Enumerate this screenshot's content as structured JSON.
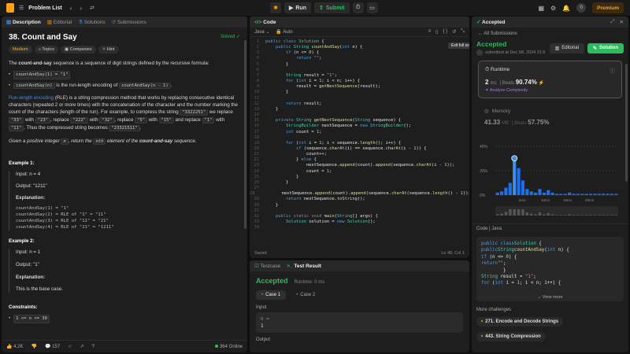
{
  "topbar": {
    "title": "Problem List",
    "run": "Run",
    "submit": "Submit",
    "avatar": "0",
    "premium": "Premium"
  },
  "left": {
    "tabs": [
      "Description",
      "Editorial",
      "Solutions",
      "Submissions"
    ],
    "title": "38. Count and Say",
    "solved": "Solved",
    "tags": [
      "Medium",
      "Topics",
      "Companies",
      "Hint"
    ],
    "intro_b": "count-and-say",
    "intro_pre": "The ",
    "intro_post": " sequence is a sequence of digit strings defined by the recursive formula:",
    "bul1": "countAndSay(1) = \"1\"",
    "bul2_code": "countAndSay(n)",
    "bul2_text": " is the run-length encoding of ",
    "bul2_code2": "countAndSay(n - 1)",
    "bul2_end": ".",
    "rle_link": "Run-length encoding",
    "rle_text": " (RLE) is a string compression method that works by replacing consecutive identical characters (repeated 2 or more times) with the concatenation of the character and the number marking the count of the characters (length of the run). For example, to compress the string ",
    "rle_c1": "\"3322251\"",
    "rle_t2": " we replace ",
    "rle_c2": "\"33\"",
    "rle_t3": " with ",
    "rle_c3": "\"23\"",
    "rle_t4": ", replace ",
    "rle_c4": "\"222\"",
    "rle_t5": " with ",
    "rle_c5": "\"32\"",
    "rle_t6": ", replace ",
    "rle_c6": "\"5\"",
    "rle_t7": " with ",
    "rle_c7": "\"15\"",
    "rle_t8": " and replace ",
    "rle_c8": "\"1\"",
    "rle_t9": " with ",
    "rle_c9": "\"11\"",
    "rle_t10": ". Thus the compressed string becomes ",
    "rle_c10": "\"23321511\"",
    "rle_t11": ".",
    "given_pre": "Given a positive integer ",
    "given_n": "n",
    "given_mid": ", return the ",
    "given_nth": "nth",
    "given_mid2": " element of the ",
    "given_b": "count-and-say",
    "given_end": " sequence.",
    "ex1": "Example 1:",
    "ex1_input": "Input: n = 4",
    "ex1_output": "Output: \"1211\"",
    "ex1_expl": "Explanation:",
    "ex1_lines": [
      "countAndSay(1) = \"1\"",
      "countAndSay(2) = RLE of \"1\" = \"11\"",
      "countAndSay(3) = RLE of \"11\" = \"21\"",
      "countAndSay(4) = RLE of \"21\" = \"1211\""
    ],
    "ex2": "Example 2:",
    "ex2_input": "Input: n = 1",
    "ex2_output": "Output: \"1\"",
    "ex2_expl": "Explanation:",
    "ex2_text": "This is the base case.",
    "constraints": "Constraints:",
    "con1": "1 <= n <= 30",
    "footer": {
      "likes": "4.2K",
      "comments": "157",
      "online": "364 Online"
    }
  },
  "code": {
    "header": "Code",
    "lang": "Java",
    "auto": "Auto",
    "tooltip": "Exit full screen",
    "saved": "Saved",
    "position": "Ln 48, Col 1",
    "lines": [
      {
        "n": "1",
        "h": "<span class='kw'>public class</span> <span class='ty'>Solution</span> {"
      },
      {
        "n": "2",
        "h": "    <span class='kw'>public</span> <span class='ty'>String</span> <span class='fn'>countAndSay</span>(<span class='kw'>int</span> n) {"
      },
      {
        "n": "3",
        "h": "        <span class='kw'>if</span> (n &lt;= <span class='nm'>0</span>) {"
      },
      {
        "n": "4",
        "h": "            <span class='kw'>return</span> <span class='st'>\"\"</span>;"
      },
      {
        "n": "5",
        "h": "        }"
      },
      {
        "n": "6",
        "h": ""
      },
      {
        "n": "7",
        "h": "        <span class='ty'>String</span> result = <span class='st'>\"1\"</span>;"
      },
      {
        "n": "8",
        "h": "        <span class='kw'>for</span> (<span class='kw'>int</span> i = <span class='nm'>1</span>; i &lt; n; i++) {"
      },
      {
        "n": "9",
        "h": "            result = <span class='fn'>getNextSequence</span>(result);"
      },
      {
        "n": "10",
        "h": "        }"
      },
      {
        "n": "11",
        "h": ""
      },
      {
        "n": "12",
        "h": "        <span class='kw'>return</span> result;"
      },
      {
        "n": "13",
        "h": "    }"
      },
      {
        "n": "14",
        "h": ""
      },
      {
        "n": "15",
        "h": "    <span class='kw'>private</span> <span class='ty'>String</span> <span class='fn'>getNextSequence</span>(<span class='ty'>String</span> sequence) {"
      },
      {
        "n": "16",
        "h": "        <span class='ty'>StringBuilder</span> nextSequence = <span class='kw'>new</span> <span class='ty'>StringBuilder</span>();"
      },
      {
        "n": "17",
        "h": "        <span class='kw'>int</span> count = <span class='nm'>1</span>;"
      },
      {
        "n": "18",
        "h": ""
      },
      {
        "n": "19",
        "h": "        <span class='kw'>for</span> (<span class='kw'>int</span> i = <span class='nm'>1</span>; i &lt; sequence.<span class='fn'>length</span>(); i++) {"
      },
      {
        "n": "20",
        "h": "            <span class='kw'>if</span> (sequence.<span class='fn'>charAt</span>(i) == sequence.<span class='fn'>charAt</span>(i - <span class='nm'>1</span>)) {"
      },
      {
        "n": "21",
        "h": "                count++;"
      },
      {
        "n": "22",
        "h": "            } <span class='kw'>else</span> {"
      },
      {
        "n": "23",
        "h": "                nextSequence.<span class='fn'>append</span>(count).<span class='fn'>append</span>(sequence.<span class='fn'>charAt</span>(i - <span class='nm'>1</span>));"
      },
      {
        "n": "24",
        "h": "                count = <span class='nm'>1</span>;"
      },
      {
        "n": "25",
        "h": "            }"
      },
      {
        "n": "26",
        "h": "        }"
      },
      {
        "n": "27",
        "h": ""
      },
      {
        "n": "28",
        "h": "        nextSequence.<span class='fn'>append</span>(count).<span class='fn'>append</span>(sequence.<span class='fn'>charAt</span>(sequence.<span class='fn'>length</span>() - <span class='nm'>1</span>));"
      },
      {
        "n": "29",
        "h": "        <span class='kw'>return</span> nextSequence.<span class='fn'>toString</span>();"
      },
      {
        "n": "30",
        "h": "    }"
      },
      {
        "n": "31",
        "h": ""
      },
      {
        "n": "32",
        "h": "    <span class='kw'>public static void</span> <span class='fn'>main</span>(<span class='ty'>String</span>[] args) {"
      },
      {
        "n": "33",
        "h": "        <span class='ty'>Solution</span> solution = <span class='kw'>new</span> <span class='ty'>Solution</span>();"
      },
      {
        "n": "34",
        "h": ""
      }
    ]
  },
  "testresult": {
    "tab1": "Testcase",
    "tab2": "Test Result",
    "status": "Accepted",
    "runtime": "Runtime: 0 ms",
    "case1": "Case 1",
    "case2": "Case 2",
    "input_label": "Input",
    "input_var": "n =",
    "input_val": "1",
    "output_label": "Output"
  },
  "right": {
    "header": "Accepted",
    "all": "All Submissions",
    "status": "Accepted",
    "submitted": "submitted at Dec 08, 2024 21:5",
    "editorial": "Editorial",
    "solution": "Solution",
    "runtime_title": "Runtime",
    "runtime_val": "2",
    "runtime_unit": "ms",
    "runtime_beats_label": "Beats",
    "runtime_beats": "90.74%",
    "analyze": "Analyze Complexity",
    "memory_title": "Memory",
    "memory_val": "41.33",
    "memory_unit": "MB",
    "memory_beats_label": "Beats",
    "memory_beats": "57.75%",
    "code_label": "Code",
    "code_lang": "Java",
    "code_lines": [
      "<span class='kw'>public class</span> <span class='ty'>Solution</span> {",
      "    <span class='kw'>public</span> <span class='ty'>String</span> <span class='fn'>countAndSay</span>(<span class='kw'>int</span> n) {",
      "        <span class='kw'>if</span> (n &lt;= <span class='nm'>0</span>) {",
      "            <span class='kw'>return</span> <span class='st'>\"\"</span>;",
      "        }",
      "",
      "        <span class='ty'>String</span> result = <span class='st'>\"1\"</span>;",
      "        <span class='kw'>for</span> (<span class='kw'>int</span> i = <span class='nm'>1</span>; i &lt; n; i++) {"
    ],
    "view_more": "View more",
    "more_title": "More challenges",
    "more1": "271. Encode and Decode Strings",
    "more2": "443. String Compression"
  },
  "chart_data": {
    "type": "bar",
    "title": "",
    "yticks": [
      "40%",
      "20%",
      "0%"
    ],
    "xticks": [
      "5ms",
      "10ms",
      "15ms",
      "20ms"
    ],
    "ylim": [
      0,
      45
    ],
    "values": [
      2,
      3,
      6,
      10,
      32,
      22,
      12,
      5,
      3,
      2,
      5,
      2,
      4,
      2,
      1,
      1,
      1,
      2,
      1,
      1,
      1,
      1,
      1,
      1,
      1,
      1,
      1,
      1,
      1
    ],
    "highlight_index": 4,
    "grid": true
  },
  "colors": {
    "accent": "#ffa116",
    "green": "#2cbb5d",
    "bar": "#1f6feb",
    "highlight": "#3b8eea"
  }
}
